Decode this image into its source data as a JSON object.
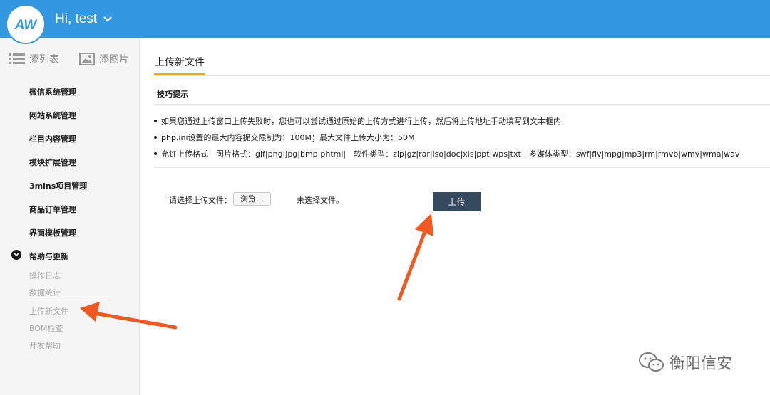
{
  "header": {
    "greeting": "Hi, test",
    "logo_text": "AW",
    "bg_color": "#3498e0"
  },
  "sidebar": {
    "quick_actions": [
      {
        "label": "添列表",
        "icon": "list-icon"
      },
      {
        "label": "添图片",
        "icon": "image-icon"
      }
    ],
    "menu": [
      "微信系统管理",
      "网站系统管理",
      "栏目内容管理",
      "模块扩展管理",
      "3mins项目管理",
      "商品订单管理",
      "界面模板管理",
      "帮助与更新"
    ],
    "submenu": [
      "操作日志",
      "数据统计",
      "上传新文件",
      "BOM检查",
      "开发帮助"
    ]
  },
  "main": {
    "tab_title": "上传新文件",
    "tips_title": "技巧提示",
    "tips": [
      "如果您通过上传窗口上传失败时，您也可以尝试通过原始的上传方式进行上传，然后将上传地址手动填写到文本框内",
      "php.ini设置的最大内容提交限制为：100M；最大文件上传大小为：50M",
      "允许上传格式　图片格式：gif|png|jpg|bmp|phtml|　软件类型：zip|gz|rar|iso|doc|xls|ppt|wps|txt　多媒体类型：swf|flv|mpg|mp3|rm|rmvb|wmv|wma|wav"
    ],
    "upload": {
      "label": "请选择上传文件：",
      "browse_label": "浏览...",
      "no_file_text": "未选择文件。",
      "submit_label": "上传"
    }
  },
  "watermark": {
    "text": "衡阳信安"
  },
  "colors": {
    "accent": "#3498e0",
    "tab_underline": "#f5a623",
    "upload_button": "#34495e",
    "annotation_arrow": "#f05a22"
  }
}
